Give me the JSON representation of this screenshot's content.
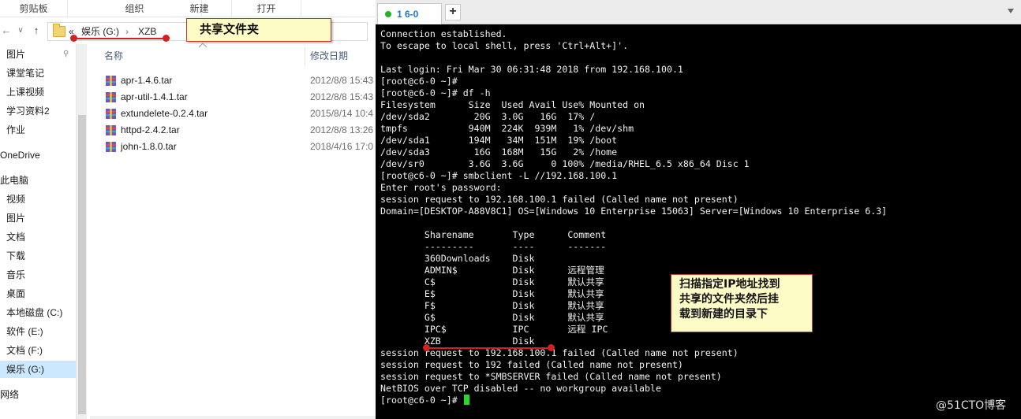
{
  "explorer": {
    "ribbon_groups": [
      "剪贴板",
      "组织",
      "新建",
      "打开"
    ],
    "nav": {
      "back": "←",
      "forward": "→",
      "dropdown": "∨",
      "up": "↑"
    },
    "breadcrumb": {
      "overflow": "«",
      "drive": "娱乐 (G:)",
      "separator": "›",
      "folder": "XZB"
    },
    "columns": {
      "name": "名称",
      "modified": "修改日期"
    },
    "sidebar_items": [
      "图片",
      "课堂笔记",
      "上课视频",
      "学习资料2",
      "作业",
      "OneDrive",
      "此电脑",
      "视频",
      "图片",
      "文档",
      "下载",
      "音乐",
      "桌面",
      "本地磁盘 (C:)",
      "软件 (E:)",
      "文档 (F:)",
      "娱乐 (G:)",
      "网络"
    ],
    "selected_sidebar_index": 16,
    "files": [
      {
        "name": "apr-1.4.6.tar",
        "modified": "2012/8/8 15:43"
      },
      {
        "name": "apr-util-1.4.1.tar",
        "modified": "2012/8/8 15:43"
      },
      {
        "name": "extundelete-0.2.4.tar",
        "modified": "2015/8/14 10:4"
      },
      {
        "name": "httpd-2.4.2.tar",
        "modified": "2012/8/8 13:26"
      },
      {
        "name": "john-1.8.0.tar",
        "modified": "2018/4/16 17:0"
      }
    ],
    "callout": "共享文件夹"
  },
  "terminal": {
    "tab_label": "1 6-0",
    "tab_add": "+",
    "lines": [
      "Connection established.",
      "To escape to local shell, press 'Ctrl+Alt+]'.",
      "",
      "Last login: Fri Mar 30 06:31:48 2018 from 192.168.100.1",
      "[root@c6-0 ~]#",
      "[root@c6-0 ~]# df -h",
      "Filesystem      Size  Used Avail Use% Mounted on",
      "/dev/sda2        20G  3.0G   16G  17% /",
      "tmpfs           940M  224K  939M   1% /dev/shm",
      "/dev/sda1       194M   34M  151M  19% /boot",
      "/dev/sda3        16G  168M   15G   2% /home",
      "/dev/sr0        3.6G  3.6G     0 100% /media/RHEL_6.5 x86_64 Disc 1",
      "[root@c6-0 ~]# smbclient -L //192.168.100.1",
      "Enter root's password:",
      "session request to 192.168.100.1 failed (Called name not present)",
      "Domain=[DESKTOP-A88V8C1] OS=[Windows 10 Enterprise 15063] Server=[Windows 10 Enterprise 6.3]",
      "",
      "        Sharename       Type      Comment",
      "        ---------       ----      -------",
      "        360Downloads    Disk",
      "        ADMIN$          Disk      远程管理",
      "        C$              Disk      默认共享",
      "        E$              Disk      默认共享",
      "        F$              Disk      默认共享",
      "        G$              Disk      默认共享",
      "        IPC$            IPC       远程 IPC",
      "        XZB             Disk",
      "session request to 192.168.100.1 failed (Called name not present)",
      "session request to 192 failed (Called name not present)",
      "session request to *SMBSERVER failed (Called name not present)",
      "NetBIOS over TCP disabled -- no workgroup available",
      "[root@c6-0 ~]# "
    ],
    "callout_lines": [
      "扫描指定IP地址找到",
      "共享的文件夹然后挂",
      "载到新建的目录下"
    ]
  },
  "watermark": "@51CTO博客",
  "colors": {
    "terminal_bg": "#000000",
    "terminal_fg": "#f2f2f2",
    "cursor": "#2bd62b",
    "annotation_red": "#d42020",
    "callout_bg": "#fdfcc6",
    "selection": "#cce8ff",
    "tab_accent": "#1a73c8"
  }
}
